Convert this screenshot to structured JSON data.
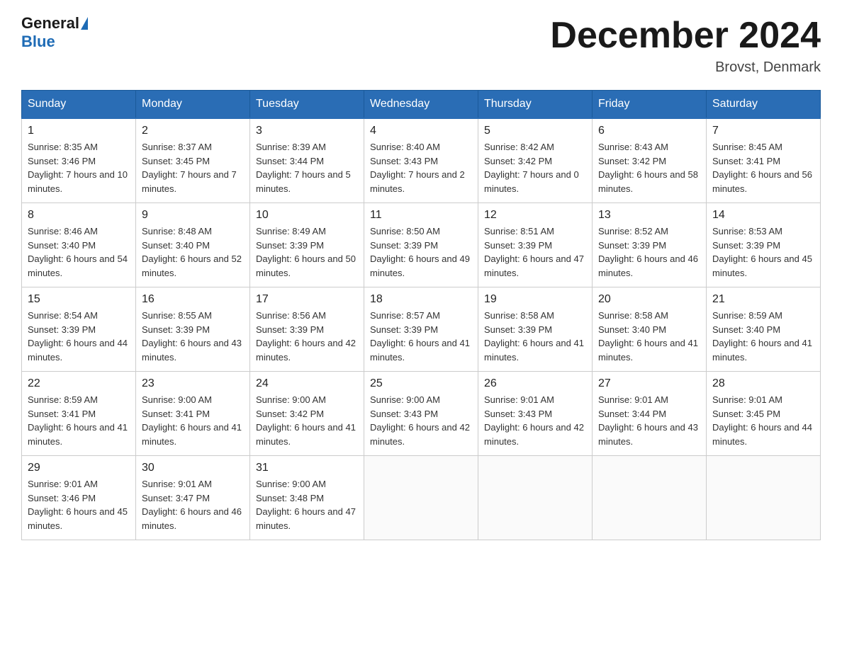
{
  "header": {
    "logo_general": "General",
    "logo_blue": "Blue",
    "month_title": "December 2024",
    "location": "Brovst, Denmark"
  },
  "days_of_week": [
    "Sunday",
    "Monday",
    "Tuesday",
    "Wednesday",
    "Thursday",
    "Friday",
    "Saturday"
  ],
  "weeks": [
    [
      {
        "day": "1",
        "sunrise": "8:35 AM",
        "sunset": "3:46 PM",
        "daylight": "7 hours and 10 minutes."
      },
      {
        "day": "2",
        "sunrise": "8:37 AM",
        "sunset": "3:45 PM",
        "daylight": "7 hours and 7 minutes."
      },
      {
        "day": "3",
        "sunrise": "8:39 AM",
        "sunset": "3:44 PM",
        "daylight": "7 hours and 5 minutes."
      },
      {
        "day": "4",
        "sunrise": "8:40 AM",
        "sunset": "3:43 PM",
        "daylight": "7 hours and 2 minutes."
      },
      {
        "day": "5",
        "sunrise": "8:42 AM",
        "sunset": "3:42 PM",
        "daylight": "7 hours and 0 minutes."
      },
      {
        "day": "6",
        "sunrise": "8:43 AM",
        "sunset": "3:42 PM",
        "daylight": "6 hours and 58 minutes."
      },
      {
        "day": "7",
        "sunrise": "8:45 AM",
        "sunset": "3:41 PM",
        "daylight": "6 hours and 56 minutes."
      }
    ],
    [
      {
        "day": "8",
        "sunrise": "8:46 AM",
        "sunset": "3:40 PM",
        "daylight": "6 hours and 54 minutes."
      },
      {
        "day": "9",
        "sunrise": "8:48 AM",
        "sunset": "3:40 PM",
        "daylight": "6 hours and 52 minutes."
      },
      {
        "day": "10",
        "sunrise": "8:49 AM",
        "sunset": "3:39 PM",
        "daylight": "6 hours and 50 minutes."
      },
      {
        "day": "11",
        "sunrise": "8:50 AM",
        "sunset": "3:39 PM",
        "daylight": "6 hours and 49 minutes."
      },
      {
        "day": "12",
        "sunrise": "8:51 AM",
        "sunset": "3:39 PM",
        "daylight": "6 hours and 47 minutes."
      },
      {
        "day": "13",
        "sunrise": "8:52 AM",
        "sunset": "3:39 PM",
        "daylight": "6 hours and 46 minutes."
      },
      {
        "day": "14",
        "sunrise": "8:53 AM",
        "sunset": "3:39 PM",
        "daylight": "6 hours and 45 minutes."
      }
    ],
    [
      {
        "day": "15",
        "sunrise": "8:54 AM",
        "sunset": "3:39 PM",
        "daylight": "6 hours and 44 minutes."
      },
      {
        "day": "16",
        "sunrise": "8:55 AM",
        "sunset": "3:39 PM",
        "daylight": "6 hours and 43 minutes."
      },
      {
        "day": "17",
        "sunrise": "8:56 AM",
        "sunset": "3:39 PM",
        "daylight": "6 hours and 42 minutes."
      },
      {
        "day": "18",
        "sunrise": "8:57 AM",
        "sunset": "3:39 PM",
        "daylight": "6 hours and 41 minutes."
      },
      {
        "day": "19",
        "sunrise": "8:58 AM",
        "sunset": "3:39 PM",
        "daylight": "6 hours and 41 minutes."
      },
      {
        "day": "20",
        "sunrise": "8:58 AM",
        "sunset": "3:40 PM",
        "daylight": "6 hours and 41 minutes."
      },
      {
        "day": "21",
        "sunrise": "8:59 AM",
        "sunset": "3:40 PM",
        "daylight": "6 hours and 41 minutes."
      }
    ],
    [
      {
        "day": "22",
        "sunrise": "8:59 AM",
        "sunset": "3:41 PM",
        "daylight": "6 hours and 41 minutes."
      },
      {
        "day": "23",
        "sunrise": "9:00 AM",
        "sunset": "3:41 PM",
        "daylight": "6 hours and 41 minutes."
      },
      {
        "day": "24",
        "sunrise": "9:00 AM",
        "sunset": "3:42 PM",
        "daylight": "6 hours and 41 minutes."
      },
      {
        "day": "25",
        "sunrise": "9:00 AM",
        "sunset": "3:43 PM",
        "daylight": "6 hours and 42 minutes."
      },
      {
        "day": "26",
        "sunrise": "9:01 AM",
        "sunset": "3:43 PM",
        "daylight": "6 hours and 42 minutes."
      },
      {
        "day": "27",
        "sunrise": "9:01 AM",
        "sunset": "3:44 PM",
        "daylight": "6 hours and 43 minutes."
      },
      {
        "day": "28",
        "sunrise": "9:01 AM",
        "sunset": "3:45 PM",
        "daylight": "6 hours and 44 minutes."
      }
    ],
    [
      {
        "day": "29",
        "sunrise": "9:01 AM",
        "sunset": "3:46 PM",
        "daylight": "6 hours and 45 minutes."
      },
      {
        "day": "30",
        "sunrise": "9:01 AM",
        "sunset": "3:47 PM",
        "daylight": "6 hours and 46 minutes."
      },
      {
        "day": "31",
        "sunrise": "9:00 AM",
        "sunset": "3:48 PM",
        "daylight": "6 hours and 47 minutes."
      },
      null,
      null,
      null,
      null
    ]
  ],
  "labels": {
    "sunrise": "Sunrise:",
    "sunset": "Sunset:",
    "daylight": "Daylight:"
  }
}
